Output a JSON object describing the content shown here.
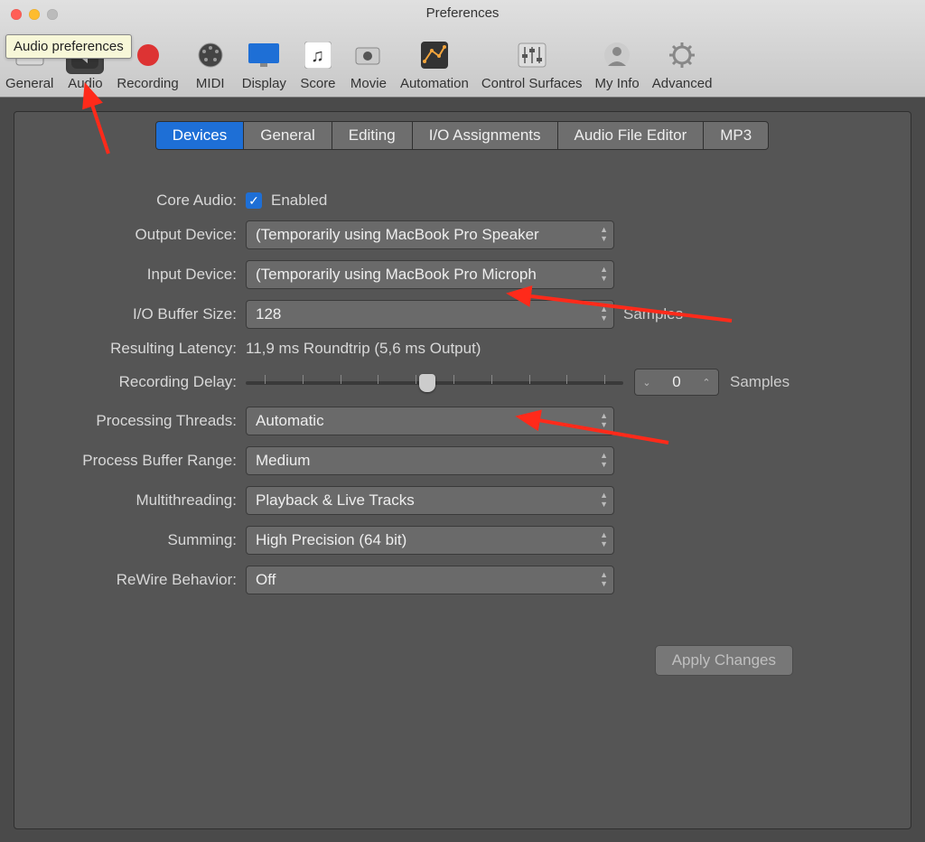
{
  "window": {
    "title": "Preferences"
  },
  "tooltip": "Audio preferences",
  "toolbar": [
    {
      "label": "General"
    },
    {
      "label": "Audio"
    },
    {
      "label": "Recording"
    },
    {
      "label": "MIDI"
    },
    {
      "label": "Display"
    },
    {
      "label": "Score"
    },
    {
      "label": "Movie"
    },
    {
      "label": "Automation"
    },
    {
      "label": "Control Surfaces"
    },
    {
      "label": "My Info"
    },
    {
      "label": "Advanced"
    }
  ],
  "subtabs": [
    "Devices",
    "General",
    "Editing",
    "I/O Assignments",
    "Audio File Editor",
    "MP3"
  ],
  "active_subtab": "Devices",
  "form": {
    "core_audio_label": "Core Audio:",
    "core_audio_value": "Enabled",
    "output_label": "Output Device:",
    "output_value": "(Temporarily using MacBook Pro Speaker",
    "input_label": "Input Device:",
    "input_value": "(Temporarily using MacBook Pro Microph",
    "iobuf_label": "I/O Buffer Size:",
    "iobuf_value": "128",
    "iobuf_suffix": "Samples",
    "latency_label": "Resulting Latency:",
    "latency_value": "11,9 ms Roundtrip (5,6 ms Output)",
    "recdelay_label": "Recording Delay:",
    "recdelay_value": "0",
    "recdelay_suffix": "Samples",
    "threads_label": "Processing Threads:",
    "threads_value": "Automatic",
    "bufrange_label": "Process Buffer Range:",
    "bufrange_value": "Medium",
    "multithread_label": "Multithreading:",
    "multithread_value": "Playback & Live Tracks",
    "summing_label": "Summing:",
    "summing_value": "High Precision (64 bit)",
    "rewire_label": "ReWire Behavior:",
    "rewire_value": "Off"
  },
  "apply_label": "Apply Changes"
}
